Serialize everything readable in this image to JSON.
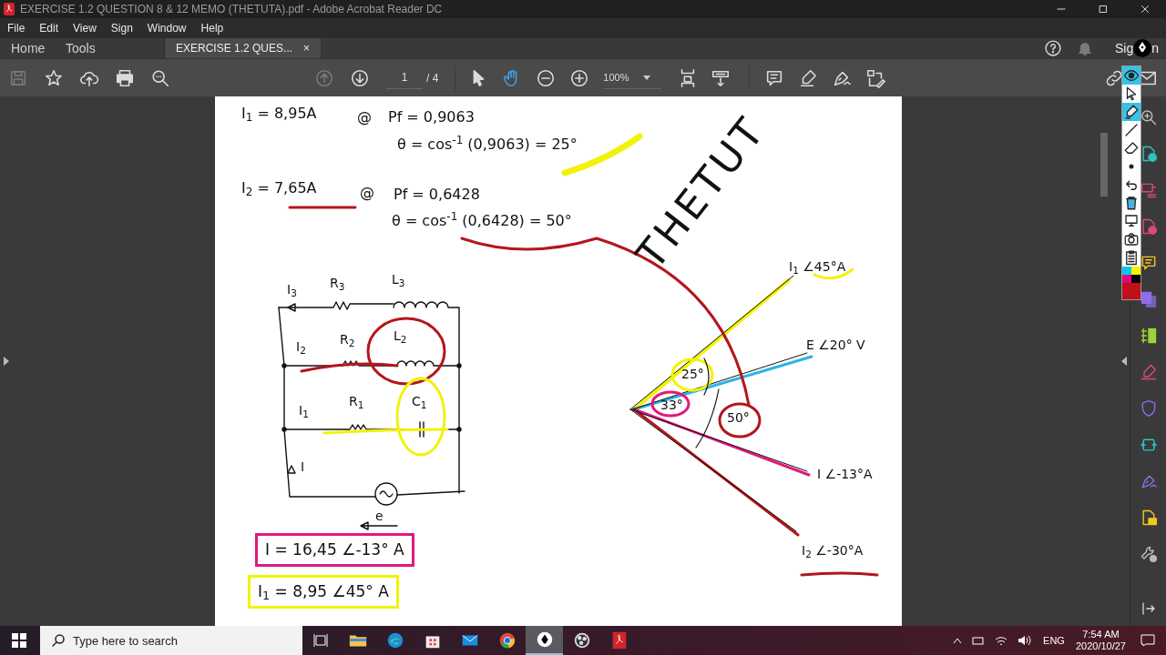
{
  "window": {
    "title": "EXERCISE 1.2 QUESTION 8 & 12 MEMO (THETUTA).pdf - Adobe Acrobat Reader DC"
  },
  "menu": [
    "File",
    "Edit",
    "View",
    "Sign",
    "Window",
    "Help"
  ],
  "tabs": [
    {
      "label": "Home",
      "selected": false
    },
    {
      "label": "Tools",
      "selected": false
    },
    {
      "label": "EXERCISE 1.2 QUES...",
      "selected": true,
      "close": "×"
    }
  ],
  "header": {
    "sign_in": [
      "Sig",
      "n"
    ]
  },
  "toolbar": {
    "file_tools": [
      {
        "kind": "save",
        "disabled": true
      },
      {
        "kind": "star",
        "disabled": false
      },
      {
        "kind": "upload",
        "disabled": false
      },
      {
        "kind": "print",
        "disabled": false
      },
      {
        "kind": "find",
        "disabled": false
      }
    ],
    "nav": [
      {
        "kind": "page-up",
        "disabled": true
      },
      {
        "kind": "page-down",
        "disabled": false
      }
    ],
    "page": "1",
    "page_total": "/ 4",
    "modes": [
      {
        "kind": "select",
        "selected": false
      },
      {
        "kind": "hand",
        "selected": true
      }
    ],
    "zoom_buttons": [
      {
        "kind": "zoom-out"
      },
      {
        "kind": "zoom-in"
      }
    ],
    "zoom": "100%",
    "view_tools": [
      {
        "kind": "fit"
      },
      {
        "kind": "scroll"
      }
    ],
    "edit_tools": [
      {
        "kind": "comment"
      },
      {
        "kind": "highlight"
      },
      {
        "kind": "sign"
      },
      {
        "kind": "edit"
      }
    ],
    "share_tools": [
      {
        "kind": "link"
      },
      {
        "kind": "mail"
      }
    ]
  },
  "page": {
    "texts": [
      {
        "kind": "equation",
        "text": "I$_{1}$ = 8,95A"
      },
      {
        "kind": "equation",
        "text": "@"
      },
      {
        "kind": "equation",
        "text": "Pf = 0,9063"
      },
      {
        "kind": "equation",
        "text": "θ = cos$^{-1}$ (0,9063) = 25°"
      },
      {
        "kind": "equation",
        "text": "I$_{2}$ = 7,65A"
      },
      {
        "kind": "equation",
        "text": "@"
      },
      {
        "kind": "equation",
        "text": "Pf = 0,6428"
      },
      {
        "kind": "equation",
        "text": "θ = cos$^{-1}$ (0,6428) = 50°"
      },
      {
        "kind": "stamp",
        "text": "THETUT"
      },
      {
        "kind": "label",
        "text": "I$_{3}$"
      },
      {
        "kind": "label",
        "text": "R$_{3}$"
      },
      {
        "kind": "label",
        "text": "L$_{3}$"
      },
      {
        "kind": "label",
        "text": "I$_{2}$"
      },
      {
        "kind": "label",
        "text": "R$_{2}$"
      },
      {
        "kind": "label",
        "text": "L$_{2}$"
      },
      {
        "kind": "label",
        "text": "I$_{1}$"
      },
      {
        "kind": "label",
        "text": "R$_{1}$"
      },
      {
        "kind": "label",
        "text": "C$_{1}$"
      },
      {
        "kind": "label",
        "text": "I"
      },
      {
        "kind": "label",
        "text": "e"
      },
      {
        "kind": "phasor",
        "text": "I$_{1}$ ∠45°A"
      },
      {
        "kind": "phasor",
        "text": "E ∠20° V"
      },
      {
        "kind": "angle",
        "text": "25°"
      },
      {
        "kind": "angle",
        "text": "33°"
      },
      {
        "kind": "angle",
        "text": "50°"
      },
      {
        "kind": "phasor",
        "text": "I ∠-13°A"
      },
      {
        "kind": "phasor",
        "text": "I$_{2}$ ∠-30°A"
      },
      {
        "kind": "result",
        "text": "I = 16,45 ∠-13° A",
        "color": "#e0197d"
      },
      {
        "kind": "result",
        "text": "I$_{1}$ = 8,95 ∠45° A",
        "color": "#f2f20a"
      }
    ]
  },
  "ink_toolbar": {
    "tools": [
      {
        "kind": "eye",
        "selected": true
      },
      {
        "kind": "cursor",
        "selected": false
      },
      {
        "kind": "highlighter",
        "selected": true
      },
      {
        "kind": "line",
        "selected": false
      },
      {
        "kind": "eraser",
        "selected": false
      },
      {
        "kind": "dot",
        "selected": false
      },
      {
        "kind": "undo",
        "selected": false
      },
      {
        "kind": "trash",
        "selected": false
      },
      {
        "kind": "screen",
        "selected": false
      },
      {
        "kind": "camera",
        "selected": false
      },
      {
        "kind": "clipboard",
        "selected": false
      }
    ],
    "swatches": [
      {
        "color": "#00c8f0"
      },
      {
        "color": "#f5f500"
      },
      {
        "color": "#e6007e"
      },
      {
        "color": "#000000"
      }
    ],
    "current": {
      "color": "#c0101a"
    }
  },
  "right_panel": [
    {
      "kind": "zoom",
      "color": "#bbbbbb"
    },
    {
      "kind": "export",
      "color": "#2ec4c4"
    },
    {
      "kind": "organize",
      "color": "#e0457b"
    },
    {
      "kind": "create",
      "color": "#e0457b"
    },
    {
      "kind": "comment",
      "color": "#f3c623"
    },
    {
      "kind": "combine",
      "color": "#8f6ee8"
    },
    {
      "kind": "pages",
      "color": "#9bd33a"
    },
    {
      "kind": "fill",
      "color": "#e0457b"
    },
    {
      "kind": "protect",
      "color": "#8f6ee8"
    },
    {
      "kind": "compress",
      "color": "#2ec4c4"
    },
    {
      "kind": "sign",
      "color": "#8f6ee8"
    },
    {
      "kind": "send",
      "color": "#f3c623"
    },
    {
      "kind": "tools",
      "color": "#bbbbbb"
    }
  ],
  "taskbar": {
    "search": {
      "placeholder": "Type here to search"
    },
    "apps": [
      {
        "kind": "explorer",
        "active": false
      },
      {
        "kind": "edge",
        "active": false
      },
      {
        "kind": "store",
        "active": false
      },
      {
        "kind": "mail",
        "active": false
      },
      {
        "kind": "chrome",
        "active": false
      },
      {
        "kind": "pen",
        "active": true
      },
      {
        "kind": "obs",
        "active": false
      },
      {
        "kind": "acrobat",
        "active": false
      }
    ],
    "language": "ENG",
    "time": "7:54 AM",
    "date": "2020/10/27"
  }
}
